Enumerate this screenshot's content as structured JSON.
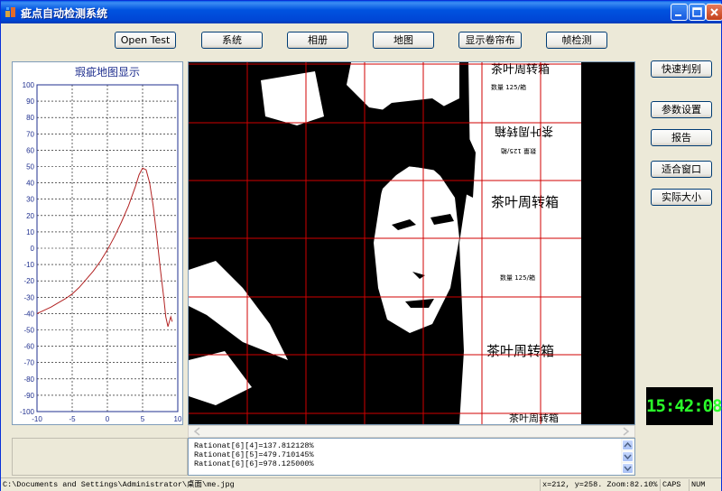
{
  "window": {
    "title": "疵点自动检测系统"
  },
  "toolbar": {
    "buttons": [
      {
        "id": "open-test",
        "label": "Open Test"
      },
      {
        "id": "system",
        "label": "系统"
      },
      {
        "id": "album",
        "label": "相册"
      },
      {
        "id": "map",
        "label": "地图"
      },
      {
        "id": "show-curtain",
        "label": "显示卷帘布"
      },
      {
        "id": "frame-detect",
        "label": "帧检测"
      }
    ]
  },
  "side_buttons": {
    "quick_judge": "快速判别",
    "param_settings": "参数设置",
    "report": "报告",
    "fit_window": "适合窗口",
    "actual_size": "实际大小"
  },
  "clock": {
    "time": "15:42:08"
  },
  "chart_data": {
    "type": "line",
    "title": "瑕疵地图显示",
    "xlim": [
      -10,
      10
    ],
    "ylim": [
      -100,
      100
    ],
    "x_ticks": [
      -10,
      -5,
      0,
      5,
      10
    ],
    "y_ticks": [
      100,
      90,
      80,
      70,
      60,
      50,
      40,
      30,
      20,
      10,
      0,
      -10,
      -20,
      -30,
      -40,
      -50,
      -60,
      -70,
      -80,
      -90,
      -100
    ],
    "grid": true,
    "line_color": "#b22222",
    "series": [
      {
        "x": [
          -10,
          -9,
          -8,
          -7,
          -6,
          -5,
          -4,
          -3,
          -2,
          -1,
          0,
          1,
          2,
          3,
          4,
          4.5,
          5,
          5.5,
          6,
          6.5,
          7,
          7.5,
          8,
          8.3,
          8.6,
          9,
          9.2
        ],
        "values": [
          -40,
          -38,
          -36,
          -33.5,
          -31,
          -28,
          -24,
          -19,
          -14,
          -8,
          -1,
          7,
          16,
          26,
          38,
          45,
          49,
          48,
          40,
          26,
          8,
          -12,
          -30,
          -42,
          -48,
          -42,
          -45
        ]
      }
    ]
  },
  "image_view": {
    "printed_text": [
      "茶叶周转箱",
      "数量 125/箱",
      "茶叶周转箱",
      "数量 125/箱",
      "茶叶周转箱",
      "茶叶周转箱",
      "数量 125/箱",
      "茶叶周转箱"
    ]
  },
  "log": {
    "lines": [
      "Rationat[6][4]=137.812128%",
      "Rationat[6][5]=479.710145%",
      "Rationat[6][6]=978.125000%"
    ]
  },
  "status": {
    "path": "C:\\Documents and Settings\\Administrator\\桌面\\me.jpg",
    "coords": "x=212, y=258. Zoom:82.10%",
    "caps": "CAPS",
    "num": "NUM"
  }
}
